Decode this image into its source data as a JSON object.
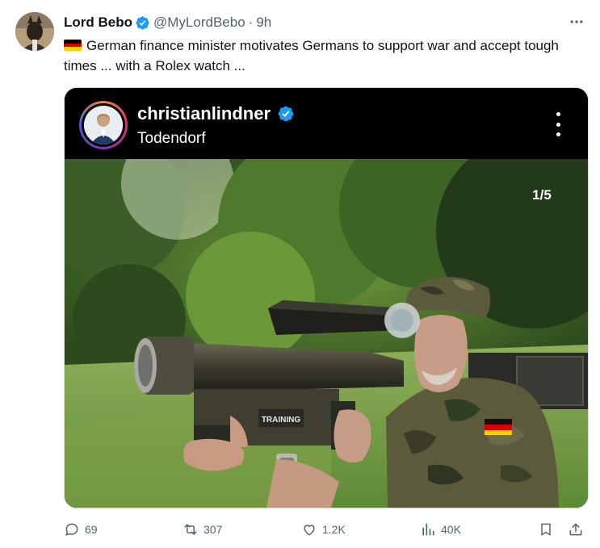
{
  "author": {
    "name": "Lord Bebo",
    "handle": "@MyLordBebo",
    "separator": "·",
    "time": "9h",
    "verified_color": "#1d9bf0"
  },
  "post": {
    "text": "German finance minister motivates Germans to support war and accept tough times ... with a Rolex watch ..."
  },
  "media": {
    "ig_username": "christianlindner",
    "ig_location": "Todendorf",
    "counter": "1/5",
    "photo_sign_text": "TRAINING"
  },
  "engagement": {
    "replies": "69",
    "reposts": "307",
    "likes": "1.2K",
    "views": "40K"
  },
  "icons": [
    "more-icon",
    "verified-icon",
    "flag-de-icon",
    "reply-icon",
    "repost-icon",
    "like-icon",
    "views-icon",
    "bookmark-icon",
    "share-icon"
  ],
  "colors": {
    "text": "#0f1419",
    "muted": "#536471",
    "accent": "#1d9bf0",
    "border": "#cfd9de"
  }
}
